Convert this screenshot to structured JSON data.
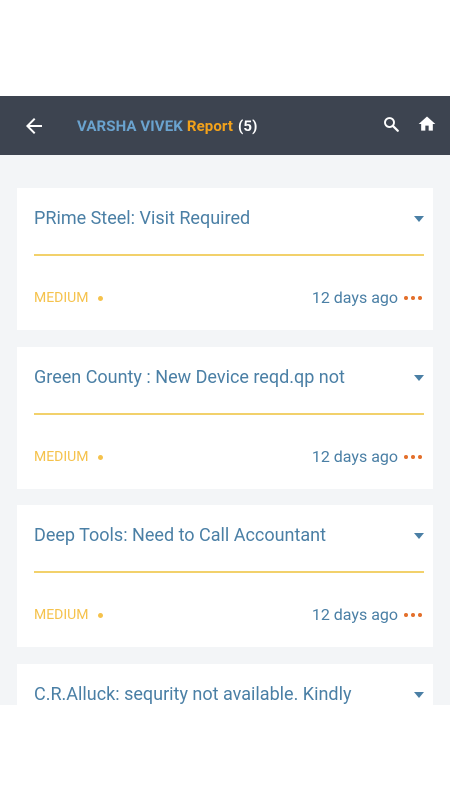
{
  "header": {
    "name": "VARSHA VIVEK",
    "report_label": "Report",
    "count": "(5)"
  },
  "icons": {
    "back": "arrow-left-icon",
    "search": "search-icon",
    "home": "home-icon",
    "expand": "caret-down-icon",
    "more": "more-horizontal-icon"
  },
  "colors": {
    "app_bar": "#3d4450",
    "name": "#6aa3cf",
    "report": "#f3a21b",
    "title_text": "#4a7fa5",
    "divider": "#f2d16b",
    "priority": "#f5c24c",
    "more": "#e36f2b",
    "background": "#f3f5f7"
  },
  "cards": [
    {
      "title": "PRime Steel: Visit Required",
      "priority": "MEDIUM",
      "time": "12 days ago"
    },
    {
      "title": "Green County : New Device reqd.qp not",
      "priority": "MEDIUM",
      "time": "12 days ago"
    },
    {
      "title": "Deep Tools: Need to Call Accountant",
      "priority": "MEDIUM",
      "time": "12 days ago"
    },
    {
      "title": "C.R.Alluck: sequrity not available. Kindly",
      "priority": "",
      "time": ""
    }
  ]
}
